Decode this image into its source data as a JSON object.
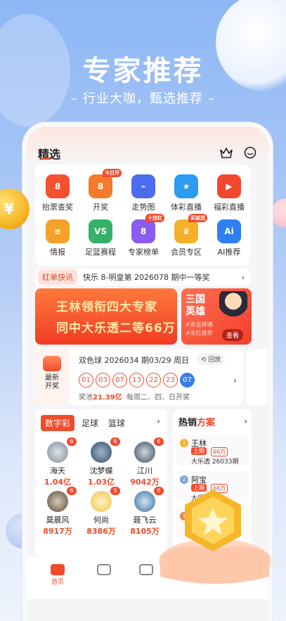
{
  "hero": {
    "headline": "专家推荐",
    "subline": "– 行业大咖，甄选推荐 –"
  },
  "app": {
    "title": "精选",
    "icons": [
      "crown-icon",
      "chat-icon"
    ]
  },
  "grid": [
    {
      "label": "抬票查奖",
      "icon": "ticket-icon",
      "color": "#f4512f",
      "tag": ""
    },
    {
      "label": "开奖",
      "icon": "draw-icon",
      "color": "#f57a2a",
      "tag": "今日开"
    },
    {
      "label": "走势图",
      "icon": "trend-icon",
      "color": "#4c6cf0",
      "tag": ""
    },
    {
      "label": "体彩直播",
      "icon": "sports-live-icon",
      "color": "#2b9cf0",
      "tag": ""
    },
    {
      "label": "福彩直播",
      "icon": "welfare-live-icon",
      "color": "#f3472d",
      "tag": ""
    },
    {
      "label": "情报",
      "icon": "intel-icon",
      "color": "#f5a12a",
      "tag": ""
    },
    {
      "label": "足篮赛程",
      "icon": "schedule-icon",
      "color": "#35b26a",
      "tag": ""
    },
    {
      "label": "专家榜单",
      "icon": "ranking-icon",
      "color": "#8a5cf0",
      "tag": "十连红"
    },
    {
      "label": "会员专区",
      "icon": "vip-icon",
      "color": "#f5b02a",
      "tag": "买就送"
    },
    {
      "label": "AI推荐",
      "icon": "ai-icon",
      "color": "#2f7ff0",
      "tag": ""
    }
  ],
  "ticker": {
    "badge": "红单快讯",
    "text": "快乐 8-明皇第 2026078 期中一等奖"
  },
  "banner": {
    "line1": "王林领衔四大专家",
    "line2": "同中大乐透二等66万",
    "coin_symbol": "¥"
  },
  "side_banner": {
    "title": "三国英雄",
    "tag1": "#各显神通",
    "tag2": "#长红推荐",
    "button": "查看"
  },
  "draw": {
    "left_label1": "最新",
    "left_label2": "开奖",
    "title": "双色球 2026034 期03/29 周日",
    "replay": "回放",
    "red_balls": [
      "01",
      "03",
      "07",
      "13",
      "22",
      "23"
    ],
    "blue_ball": "07",
    "pool_prefix": "奖池",
    "pool_value": "21.39亿",
    "pool_suffix": "每周二、四、日开奖"
  },
  "experts": {
    "tabs": [
      "数字彩",
      "足球",
      "篮球"
    ],
    "items": [
      {
        "name": "海天",
        "value": "1.04亿",
        "count": "6"
      },
      {
        "name": "沈梦蝶",
        "value": "1.03亿",
        "count": "6"
      },
      {
        "name": "江川",
        "value": "9042万",
        "count": "6"
      },
      {
        "name": "莫晨风",
        "value": "8917万",
        "count": "6"
      },
      {
        "name": "何尚",
        "value": "8386万",
        "count": "5"
      },
      {
        "name": "聂飞云",
        "value": "8105万",
        "count": "6"
      }
    ]
  },
  "hot": {
    "title1": "热销",
    "title2": "方案",
    "rows": [
      {
        "rank": "1",
        "name": "王林",
        "badge": "上期",
        "value": "66万",
        "desc": "大乐透 26033期"
      },
      {
        "rank": "2",
        "name": "阿宝",
        "badge": "上期",
        "value": "66万",
        "desc": "大乐"
      },
      {
        "rank": "3",
        "name": "",
        "badge": "",
        "value": "",
        "desc": ""
      }
    ]
  },
  "nav": [
    {
      "label": "首页",
      "icon": "home-icon"
    },
    {
      "label": "",
      "icon": "score-icon"
    },
    {
      "label": "",
      "icon": "community-icon"
    }
  ]
}
